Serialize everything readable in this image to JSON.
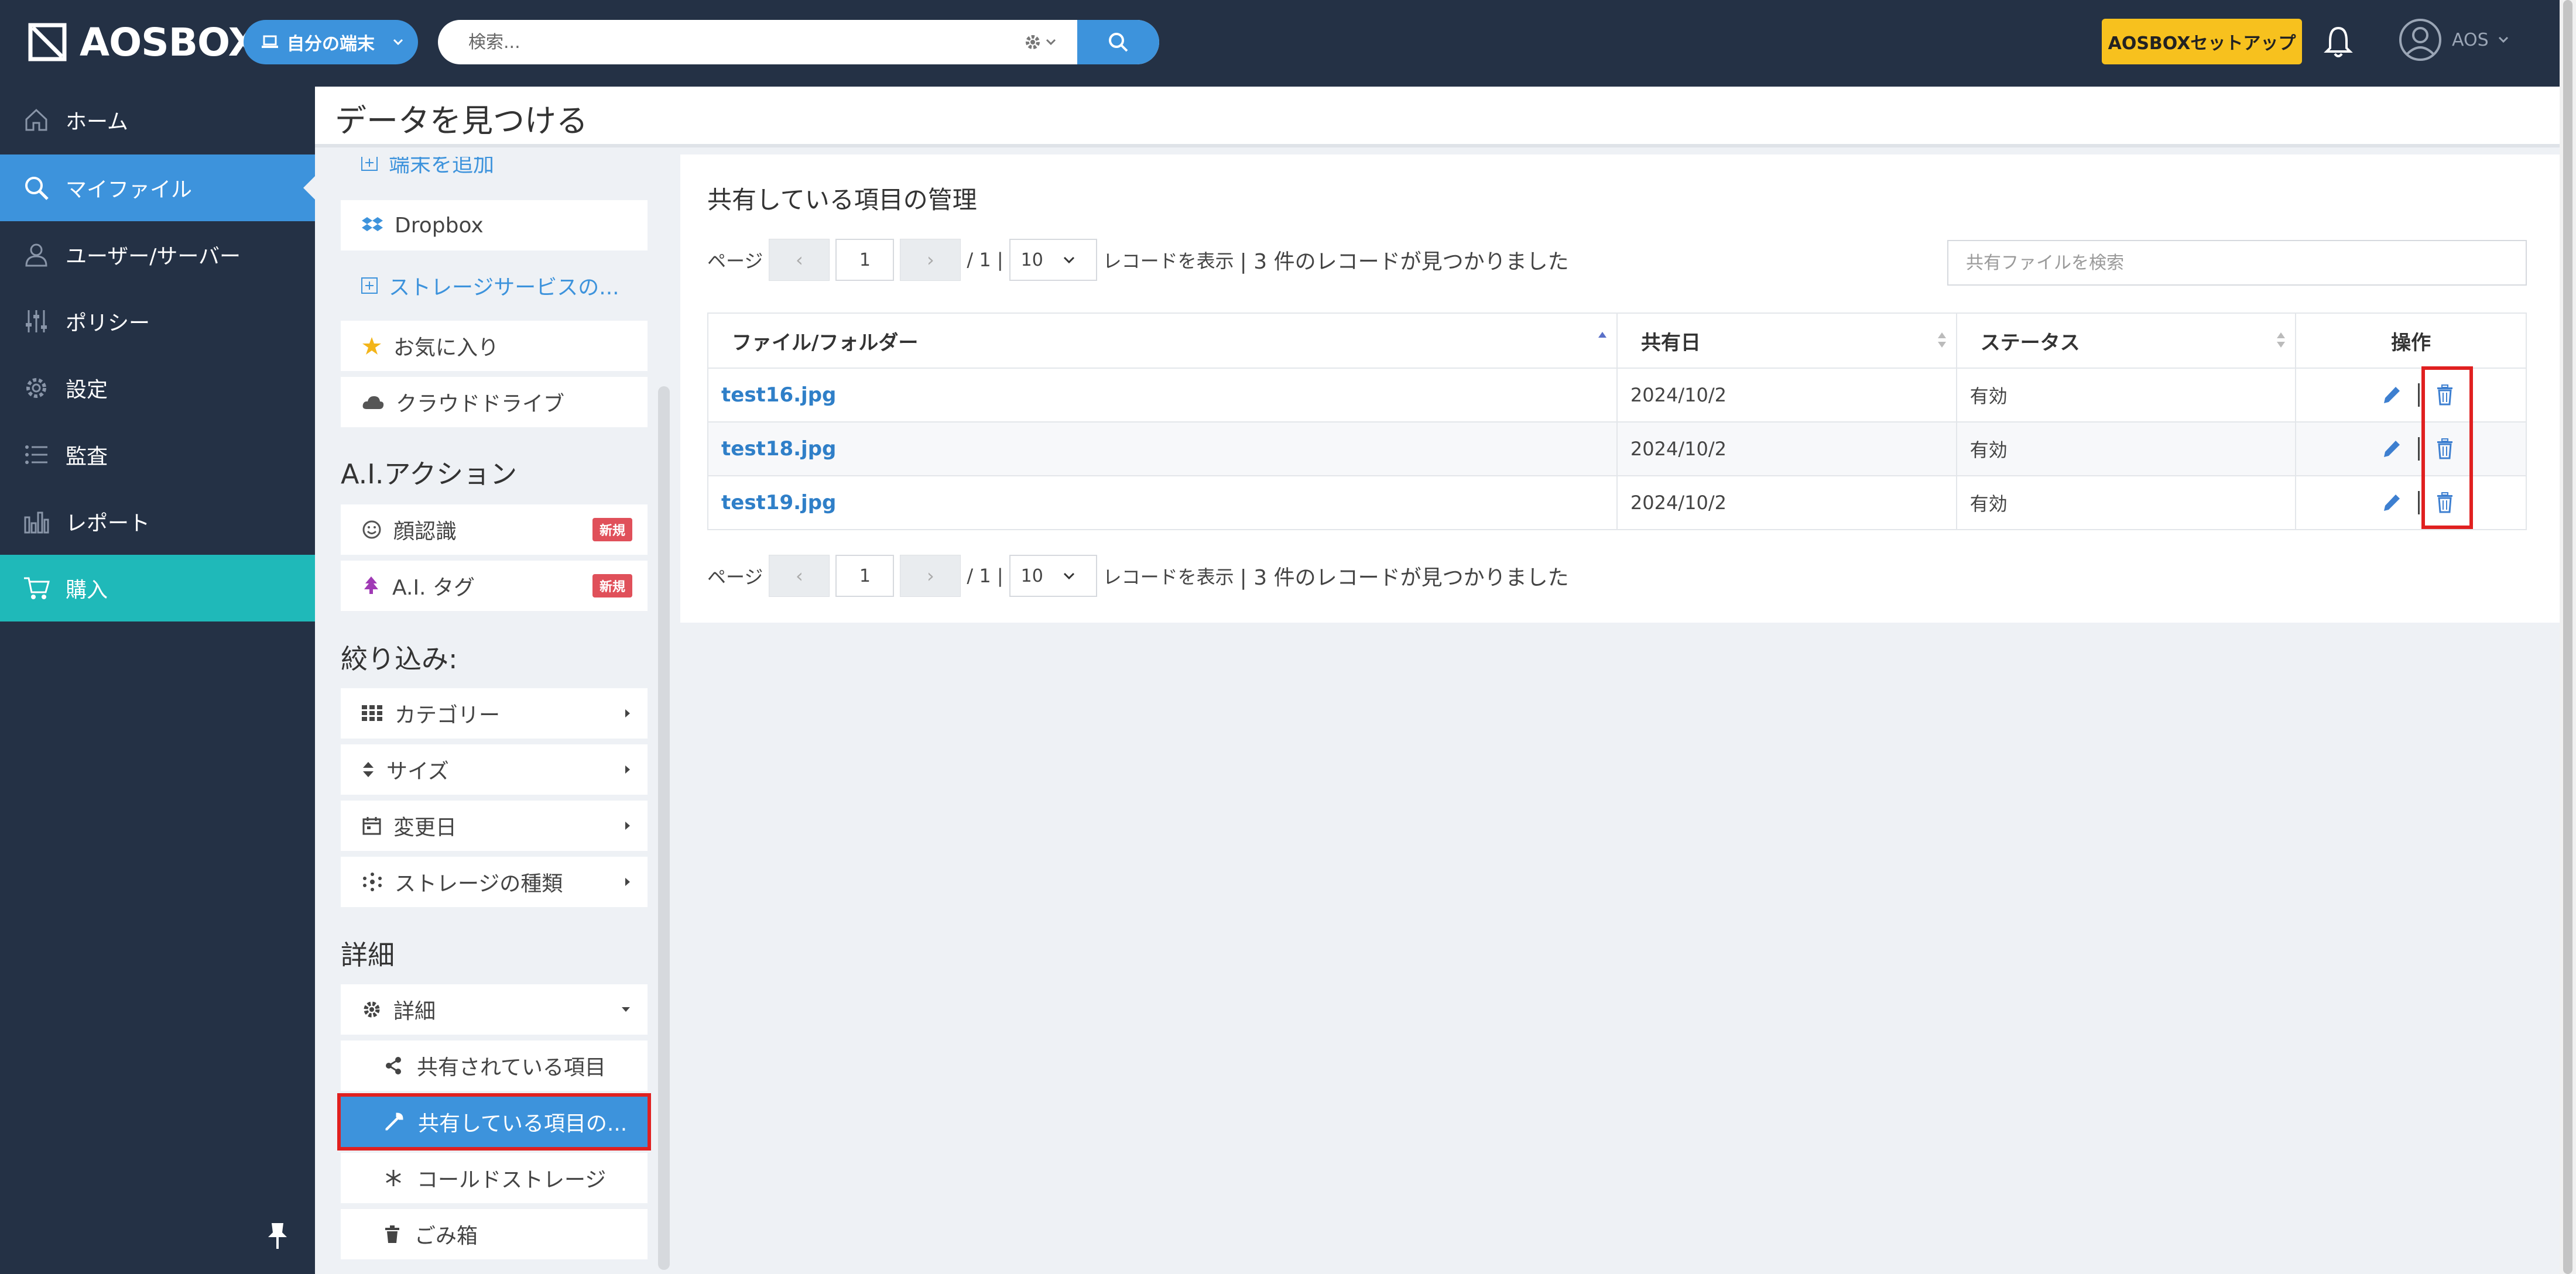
{
  "header": {
    "brand": "AOSBOX",
    "device_button": "自分の端末",
    "search_placeholder": "検索...",
    "setup_button": "AOSBOXセットアップ",
    "user": "AOS"
  },
  "leftnav": {
    "items": [
      {
        "label": "ホーム",
        "icon": "home-icon"
      },
      {
        "label": "マイファイル",
        "icon": "search-icon"
      },
      {
        "label": "ユーザー/サーバー",
        "icon": "user-icon"
      },
      {
        "label": "ポリシー",
        "icon": "sliders-icon"
      },
      {
        "label": "設定",
        "icon": "gear-icon"
      },
      {
        "label": "監査",
        "icon": "list-icon"
      },
      {
        "label": "レポート",
        "icon": "bar-chart-icon"
      },
      {
        "label": "購入",
        "icon": "cart-icon"
      }
    ]
  },
  "page": {
    "title": "データを見つける"
  },
  "filters": {
    "add_device": "端末を追加",
    "dropbox": "Dropbox",
    "add_storage": "ストレージサービスの...",
    "favorites": "お気に入り",
    "cloud_drive": "クラウドドライブ",
    "ai_section": "A.I.アクション",
    "face_recognition": "顔認識",
    "ai_tag": "A.I. タグ",
    "new_badge": "新規",
    "narrow_section": "絞り込み:",
    "category": "カテゴリー",
    "size": "サイズ",
    "modified": "変更日",
    "storage_type": "ストレージの種類",
    "detail_section": "詳細",
    "detail": "詳細",
    "shared_with_me": "共有されている項目",
    "shared_manage": "共有している項目の...",
    "cold_storage": "コールドストレージ",
    "trash": "ごみ箱"
  },
  "content": {
    "title": "共有している項目の管理",
    "pager": {
      "page_label": "ページ",
      "prev": "‹",
      "next": "›",
      "current": "1",
      "total": "/ 1 |",
      "per_page": "10",
      "show_records": "レコードを表示",
      "found": "| 3 件のレコードが見つかりました"
    },
    "search_placeholder": "共有ファイルを検索",
    "columns": [
      "ファイル/フォルダー",
      "共有日",
      "ステータス",
      "操作"
    ],
    "rows": [
      {
        "name": "test16.jpg",
        "date": "2024/10/2",
        "status": "有効"
      },
      {
        "name": "test18.jpg",
        "date": "2024/10/2",
        "status": "有効"
      },
      {
        "name": "test19.jpg",
        "date": "2024/10/2",
        "status": "有効"
      }
    ]
  },
  "colors": {
    "nav_bg": "#243145",
    "accent": "#3d93dc",
    "buy": "#1fb9b9",
    "setup": "#f7c11e",
    "highlight": "#e02020"
  }
}
